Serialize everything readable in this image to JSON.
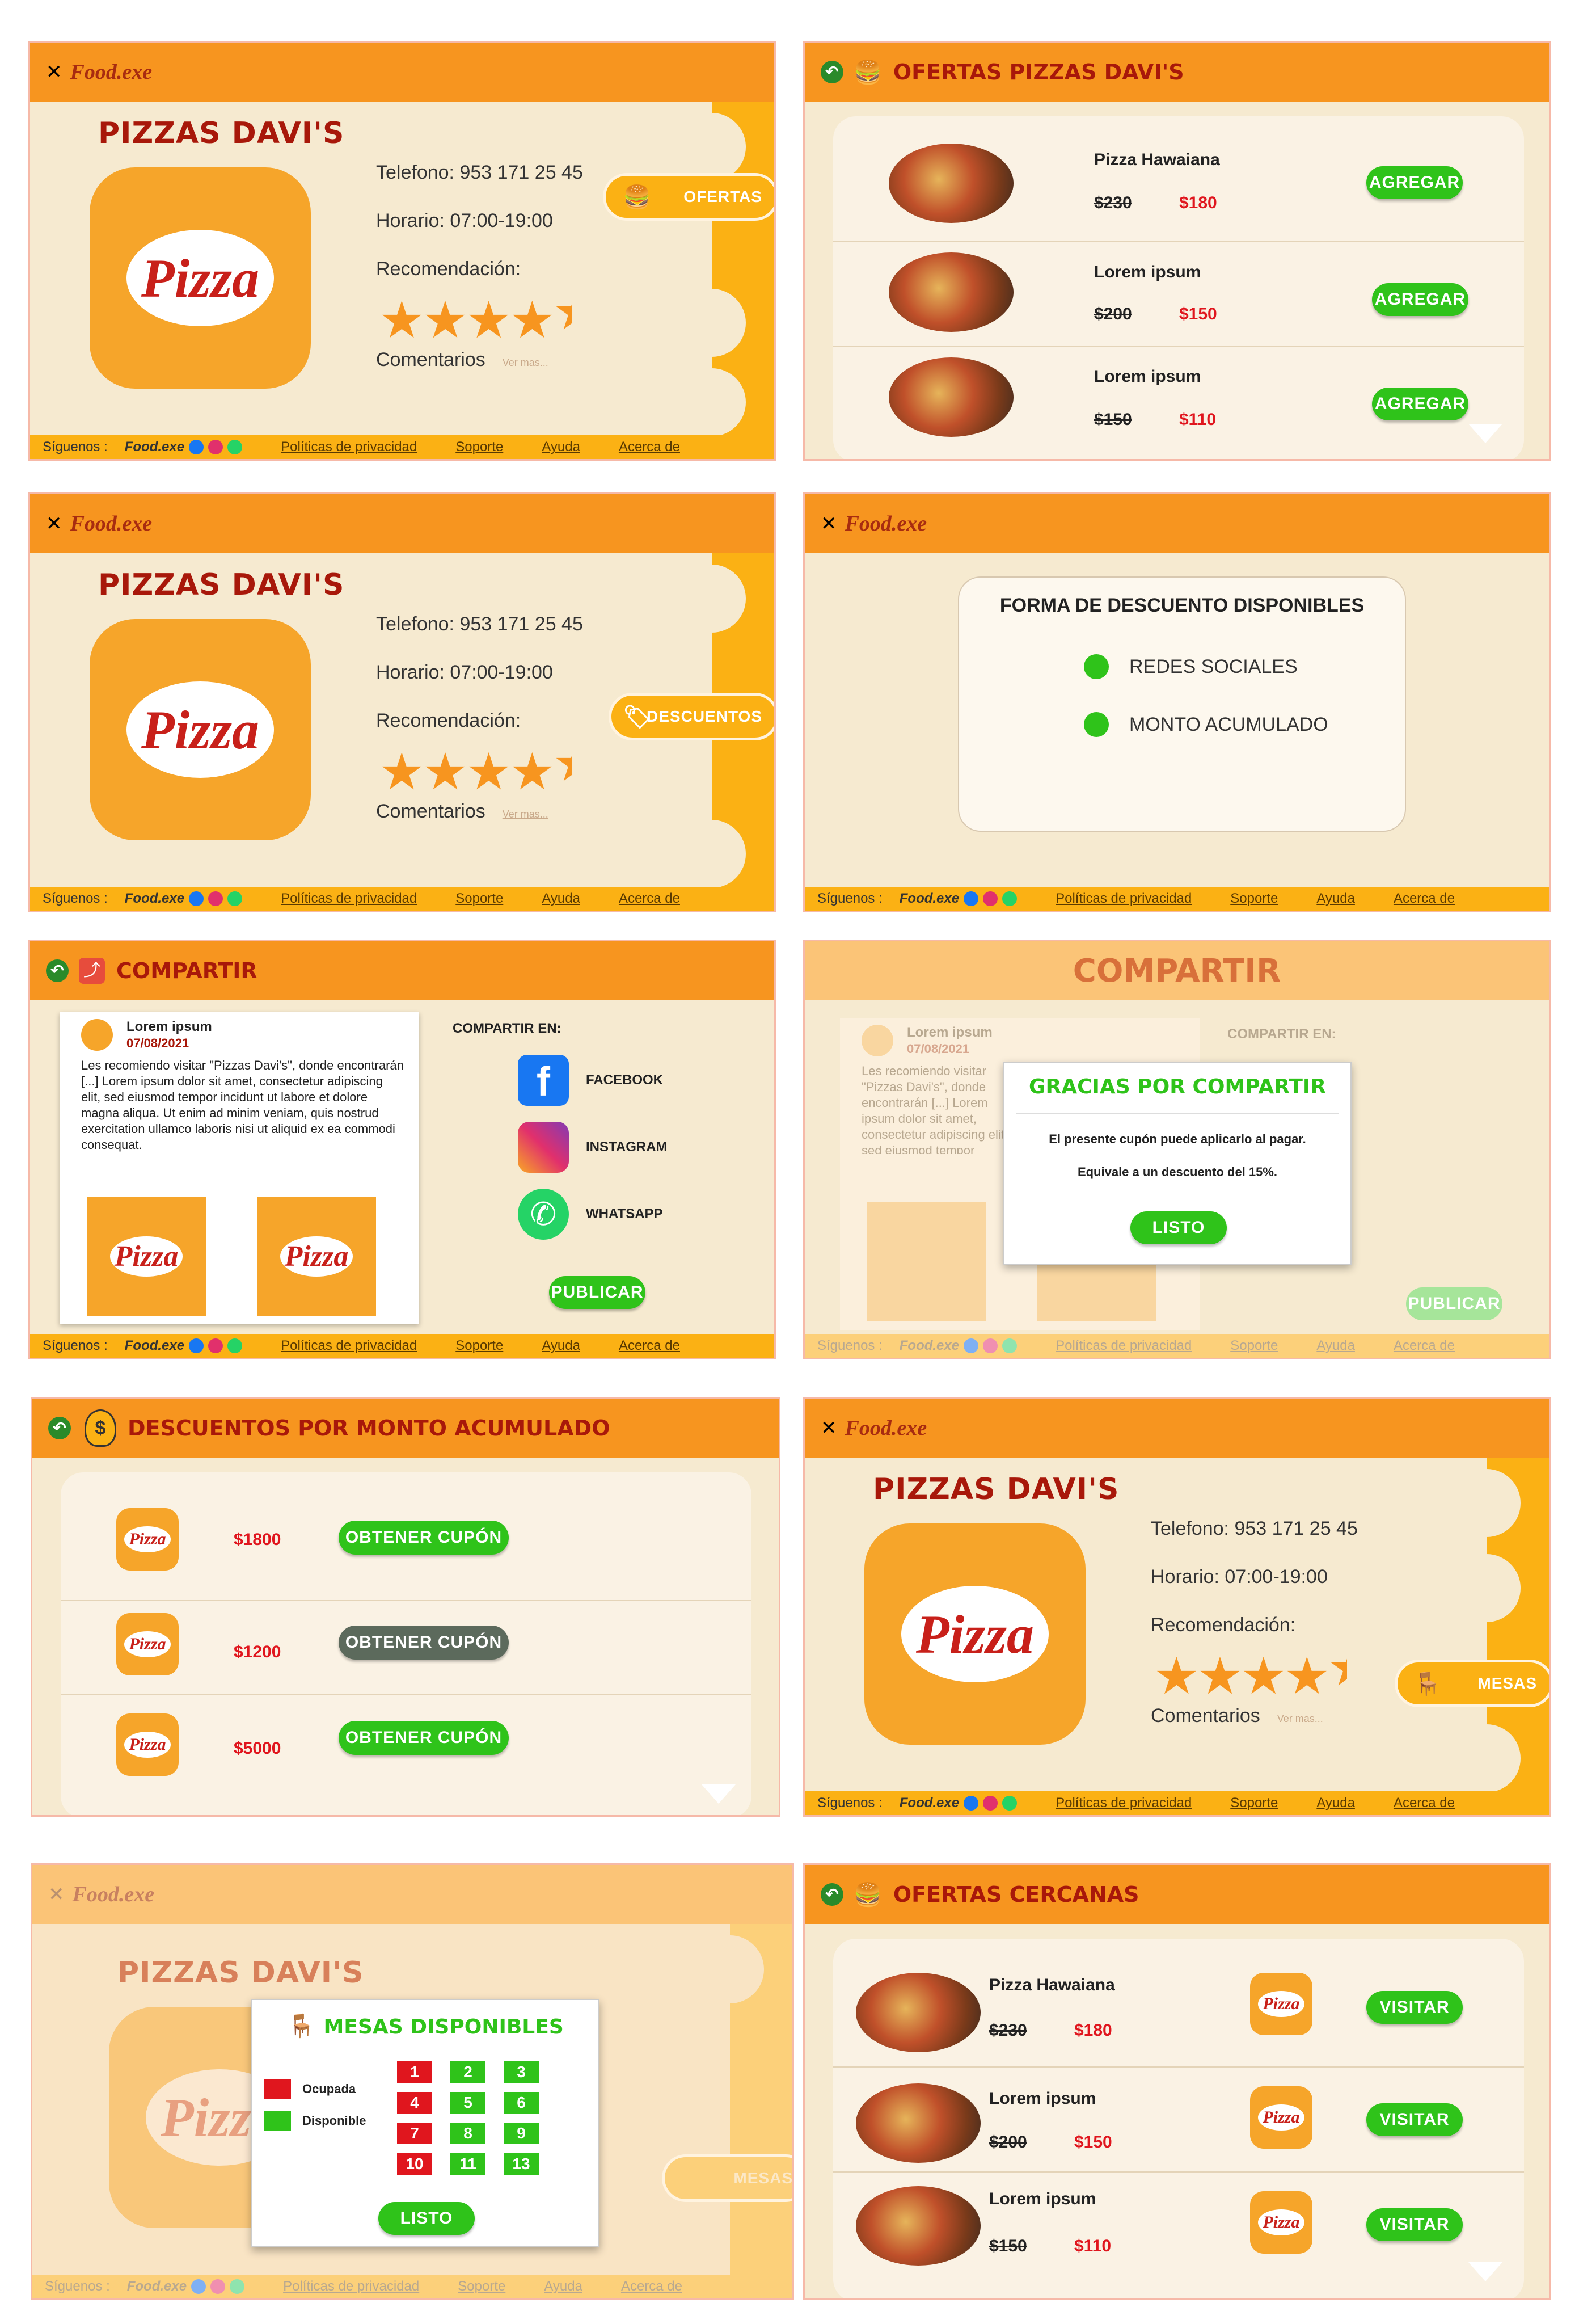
{
  "brand": "Food.exe",
  "restaurant": {
    "name": "PIZZAS DAVI'S",
    "phone": "Telefono: 953 171 25 45",
    "hours": "Horario: 07:00-19:00",
    "rec": "Recomendación:",
    "rating": 4.5,
    "comments": "Comentarios",
    "more": "Ver mas..."
  },
  "logo_text": "Pizza",
  "footer": {
    "follow": "Síguenos :",
    "brand": "Food.exe",
    "privacy": "Políticas de privacidad",
    "support": "Soporte",
    "help": "Ayuda",
    "about": "Acerca de"
  },
  "pills": {
    "offers": "OFERTAS",
    "discounts": "DESCUENTOS",
    "tables": "MESAS"
  },
  "offers": {
    "title": "OFERTAS PIZZAS DAVI'S",
    "button": "AGREGAR",
    "items": [
      {
        "name": "Pizza Hawaiana",
        "old": "$230",
        "new": "$180"
      },
      {
        "name": "Lorem ipsum",
        "old": "$200",
        "new": "$150"
      },
      {
        "name": "Lorem ipsum",
        "old": "$150",
        "new": "$110"
      }
    ]
  },
  "discount_forms": {
    "title": "FORMA DE DESCUENTO DISPONIBLES",
    "opt1": "REDES SOCIALES",
    "opt2": "MONTO ACUMULADO"
  },
  "share": {
    "title": "COMPARTIR",
    "post_user": "Lorem ipsum",
    "post_date": "07/08/2021",
    "post_text": "Les recomiendo visitar \"Pizzas Davi's\", donde encontrarán [...] Lorem ipsum dolor sit amet, consectetur adipiscing elit, sed eiusmod tempor incidunt ut labore et dolore magna aliqua. Ut enim ad minim veniam, quis nostrud exercitation ullamco laboris nisi ut aliquid ex ea commodi consequat.",
    "share_on": "COMPARTIR EN:",
    "facebook": "FACEBOOK",
    "instagram": "INSTAGRAM",
    "whatsapp": "WHATSAPP",
    "publish": "PUBLICAR"
  },
  "thanks": {
    "title": "GRACIAS POR COMPARTIR",
    "line1": "El presente cupón puede aplicarlo al pagar.",
    "line2": "Equivale a un descuento del 15%.",
    "button": "LISTO"
  },
  "accum": {
    "title": "DESCUENTOS POR MONTO ACUMULADO",
    "button": "OBTENER CUPÓN",
    "rows": [
      {
        "amount": "$1800",
        "enabled": true
      },
      {
        "amount": "$1200",
        "enabled": false
      },
      {
        "amount": "$5000",
        "enabled": true
      }
    ]
  },
  "tables": {
    "title": "MESAS DISPONIBLES",
    "occupied": "Ocupada",
    "available": "Disponible",
    "button": "LISTO",
    "cells": [
      {
        "n": "1",
        "status": "occupied"
      },
      {
        "n": "2",
        "status": "available"
      },
      {
        "n": "3",
        "status": "available"
      },
      {
        "n": "4",
        "status": "occupied"
      },
      {
        "n": "5",
        "status": "available"
      },
      {
        "n": "6",
        "status": "available"
      },
      {
        "n": "7",
        "status": "occupied"
      },
      {
        "n": "8",
        "status": "available"
      },
      {
        "n": "9",
        "status": "available"
      },
      {
        "n": "10",
        "status": "occupied"
      },
      {
        "n": "11",
        "status": "available"
      },
      {
        "n": "13",
        "status": "available"
      }
    ]
  },
  "nearby": {
    "title": "OFERTAS CERCANAS",
    "button": "VISITAR",
    "items": [
      {
        "name": "Pizza Hawaiana",
        "old": "$230",
        "new": "$180"
      },
      {
        "name": "Lorem ipsum",
        "old": "$200",
        "new": "$150"
      },
      {
        "name": "Lorem ipsum",
        "old": "$150",
        "new": "$110"
      }
    ]
  },
  "colors": {
    "header": "#f7951f",
    "accent": "#fbb114",
    "title_red": "#a8180a",
    "green": "#2fc31a",
    "price_red": "#e0161e"
  }
}
